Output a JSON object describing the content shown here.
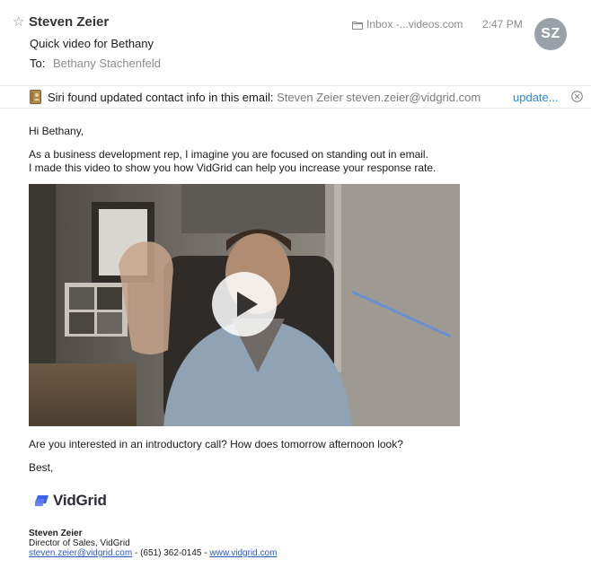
{
  "header": {
    "sender": "Steven Zeier",
    "subject": "Quick video for Bethany",
    "to_label": "To:",
    "to_value": "Bethany Stachenfeld",
    "mailbox": "Inbox -...videos.com",
    "time": "2:47 PM",
    "avatar_initials": "SZ",
    "star_icon": "star-outline-icon",
    "star_glyph": "☆"
  },
  "siri_banner": {
    "message": "Siri found updated contact info in this email:",
    "contact": "Steven Zeier steven.zeier@vidgrid.com",
    "update_label": "update...",
    "icon": "contact-card-icon"
  },
  "body": {
    "greeting": "Hi Bethany,",
    "line1": "As a business development rep, I imagine you are focused on standing out in email.",
    "line2": "I made this video to show you how VidGrid can help you increase your response rate.",
    "line3": "Are you interested in an introductory call? How does tomorrow afternoon look?",
    "closing": "Best,"
  },
  "signature": {
    "logo_text": "VidGrid",
    "name": "Steven Zeier",
    "title": "Director of Sales, VidGrid",
    "email": "steven.zeier@vidgrid.com",
    "separator1": " - ",
    "phone": "(651) 362-0145",
    "separator2": " - ",
    "website": "www.vidgrid.com"
  },
  "colors": {
    "link": "#2b57c8",
    "update_link": "#2d8bd8",
    "avatar_bg": "#9aa0a8",
    "logo_accent": "#3b5ff0"
  }
}
